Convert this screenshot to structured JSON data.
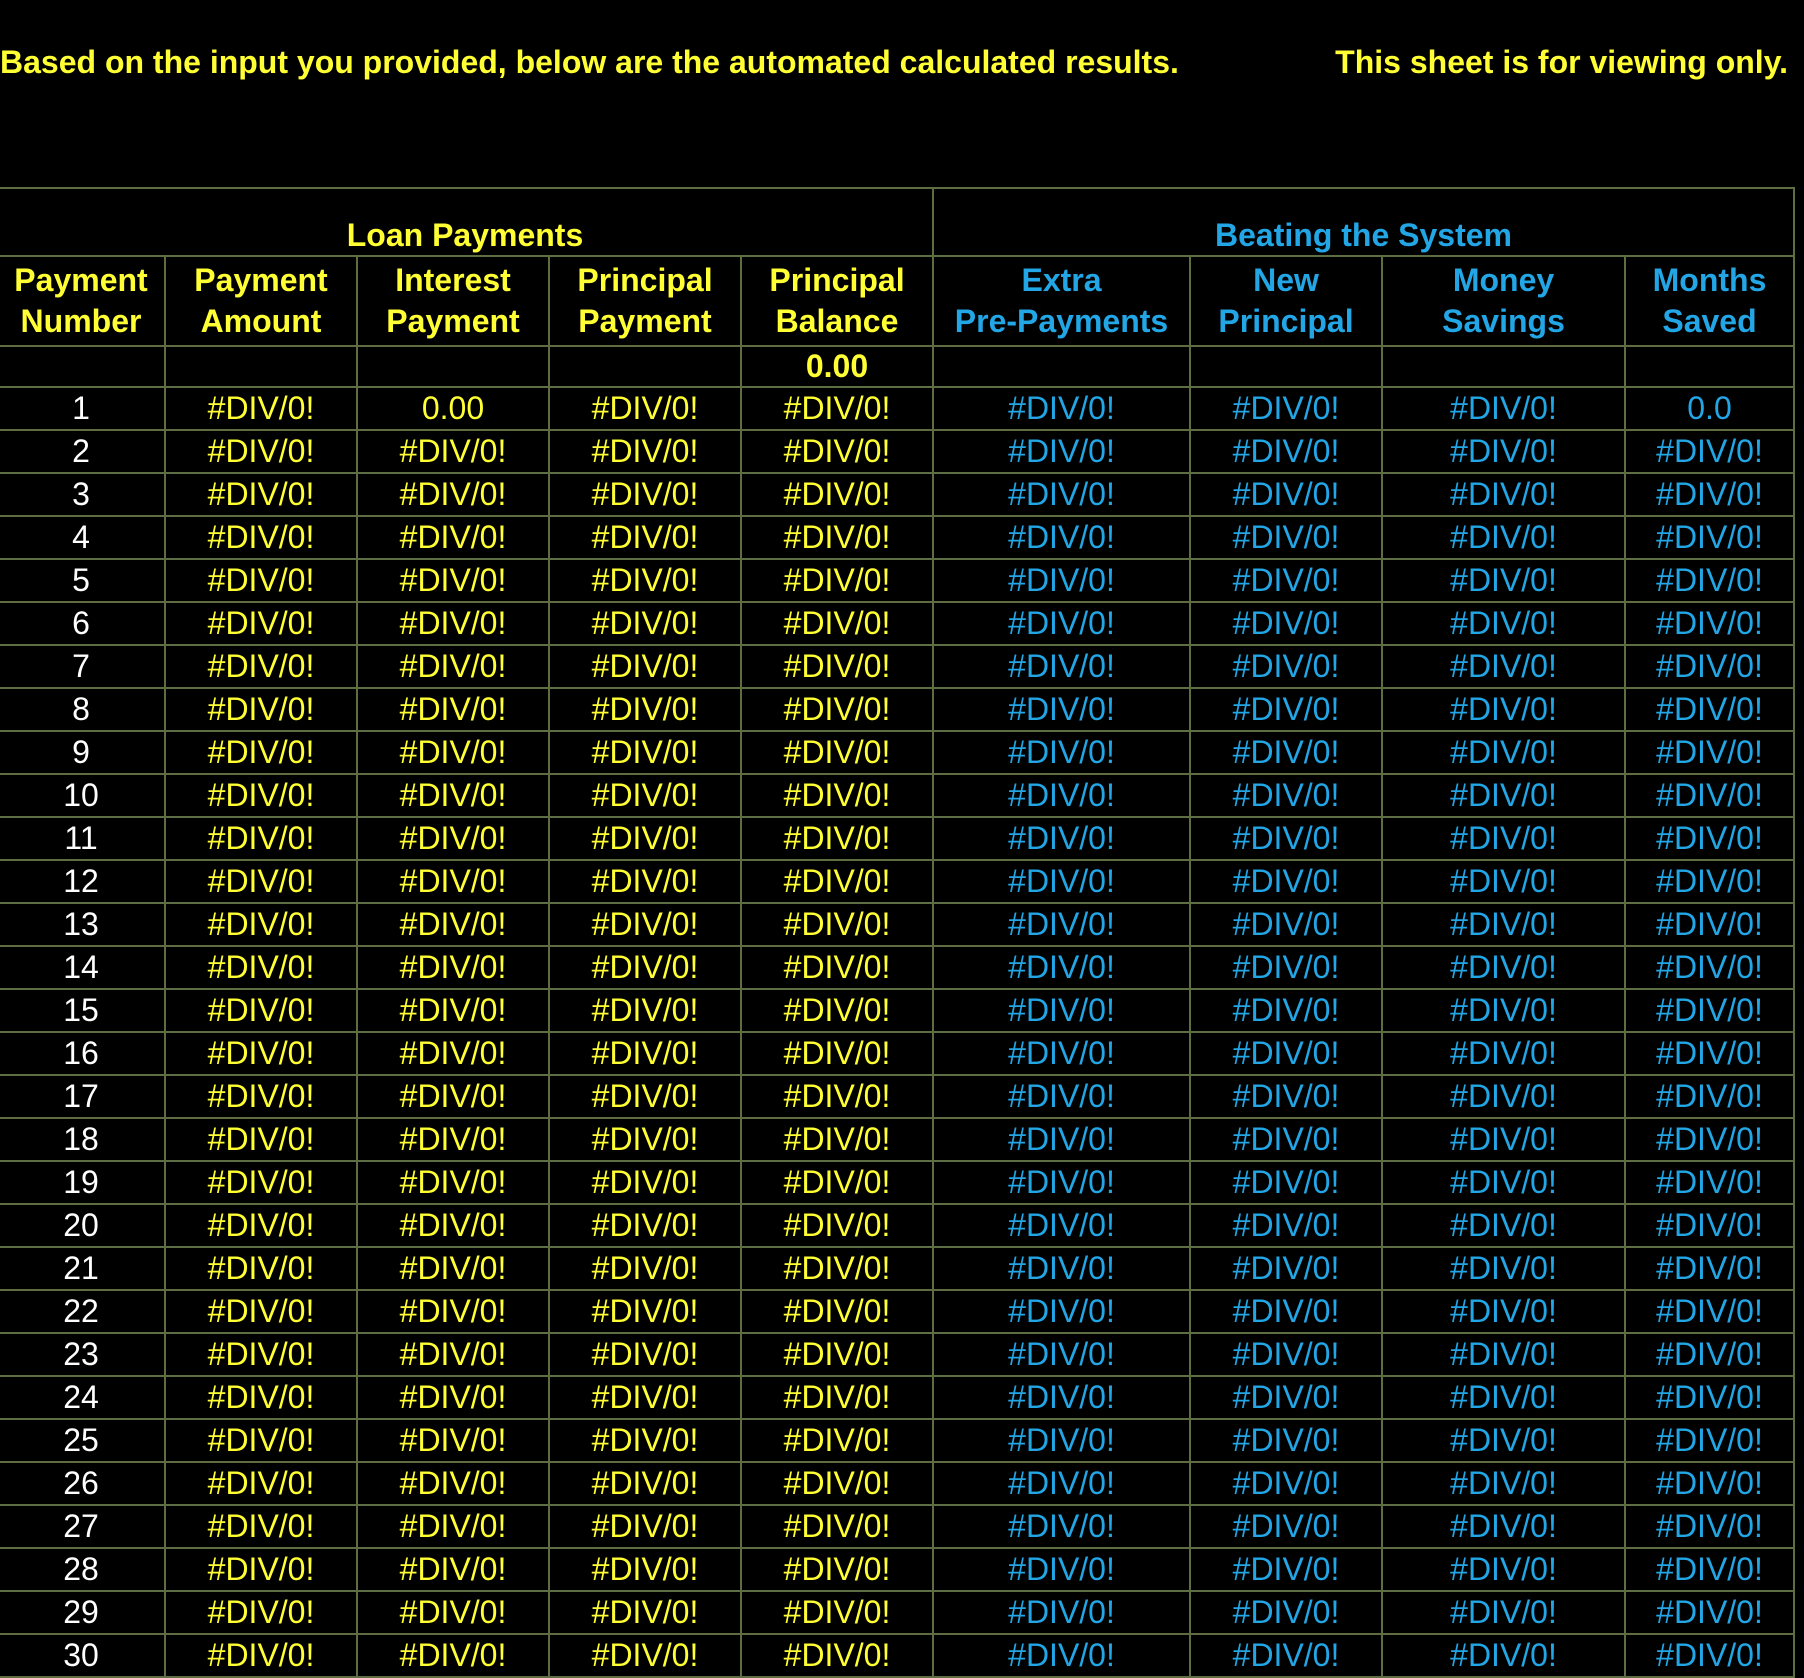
{
  "banner": {
    "left": "Based on the input you provided, below are the automated calculated results.",
    "right": "This sheet is for viewing only."
  },
  "groups": {
    "loan": "Loan Payments",
    "beating": "Beating the System"
  },
  "headers": {
    "payment_number": [
      "Payment",
      "Number"
    ],
    "payment_amount": [
      "Payment",
      "Amount"
    ],
    "interest_payment": [
      "Interest",
      "Payment"
    ],
    "principal_payment": [
      "Principal",
      "Payment"
    ],
    "principal_balance": [
      "Principal",
      "Balance"
    ],
    "extra_prepayments": [
      "Extra",
      "Pre-Payments"
    ],
    "new_principal": [
      "New",
      "Principal"
    ],
    "money_savings": [
      "Money",
      "Savings"
    ],
    "months_saved": [
      "Months",
      "Saved"
    ]
  },
  "initial_balance": "0.00",
  "error_value": "#DIV/0!",
  "first_row": {
    "interest_payment": "0.00",
    "months_saved": "0.0"
  },
  "rows": [
    {
      "n": "1"
    },
    {
      "n": "2"
    },
    {
      "n": "3"
    },
    {
      "n": "4"
    },
    {
      "n": "5"
    },
    {
      "n": "6"
    },
    {
      "n": "7"
    },
    {
      "n": "8"
    },
    {
      "n": "9"
    },
    {
      "n": "10"
    },
    {
      "n": "11"
    },
    {
      "n": "12"
    },
    {
      "n": "13"
    },
    {
      "n": "14"
    },
    {
      "n": "15"
    },
    {
      "n": "16"
    },
    {
      "n": "17"
    },
    {
      "n": "18"
    },
    {
      "n": "19"
    },
    {
      "n": "20"
    },
    {
      "n": "21"
    },
    {
      "n": "22"
    },
    {
      "n": "23"
    },
    {
      "n": "24"
    },
    {
      "n": "25"
    },
    {
      "n": "26"
    },
    {
      "n": "27"
    },
    {
      "n": "28"
    },
    {
      "n": "29"
    },
    {
      "n": "30"
    }
  ],
  "colors": {
    "background": "#000000",
    "loan_text": "#FFFF33",
    "system_text": "#22A6E6",
    "number_text": "#FFFFFF",
    "gridline": "#5f6d43"
  }
}
